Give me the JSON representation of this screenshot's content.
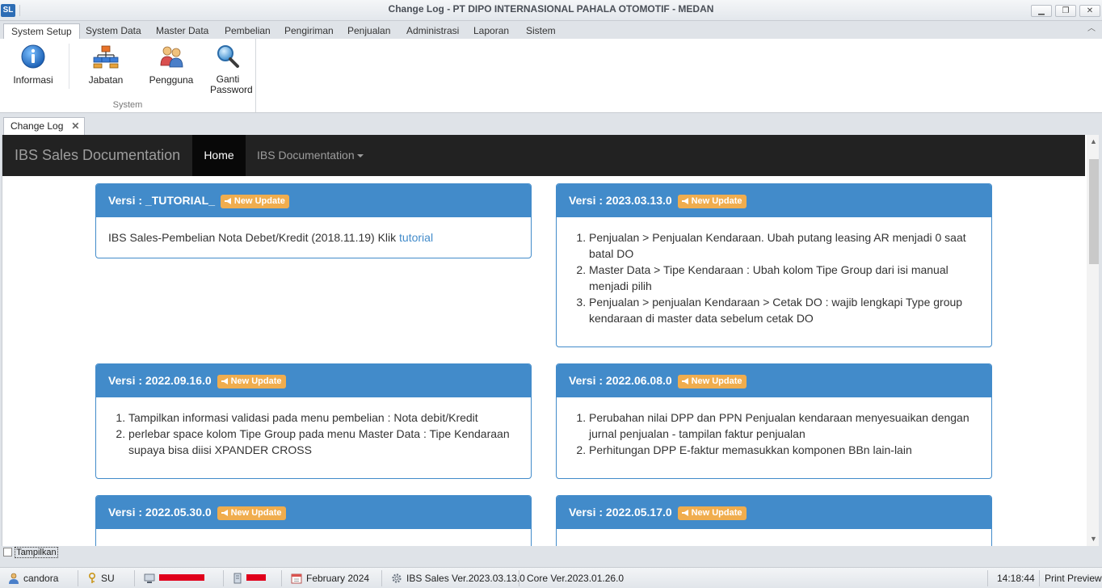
{
  "window": {
    "title": "Change Log - PT DIPO INTERNASIONAL PAHALA OTOMOTIF - MEDAN",
    "app_icon": "SL",
    "controls": [
      "minimize-icon",
      "restore-icon",
      "close-icon"
    ]
  },
  "ribbon": {
    "tabs": [
      "System Setup",
      "System Data",
      "Master Data",
      "Pembelian",
      "Pengiriman",
      "Penjualan",
      "Administrasi",
      "Laporan",
      "Sistem"
    ],
    "active_tab": "System Setup",
    "group_label": "System",
    "buttons": [
      {
        "label": "Informasi",
        "icon": "info-icon"
      },
      {
        "label": "Jabatan",
        "icon": "org-chart-icon"
      },
      {
        "label": "Pengguna",
        "icon": "users-icon"
      },
      {
        "label": "Ganti Password",
        "icon": "key-search-icon"
      }
    ]
  },
  "doc_tab": {
    "label": "Change Log",
    "close": "✕"
  },
  "site": {
    "brand": "IBS Sales Documentation",
    "nav": {
      "home": "Home",
      "docs": "IBS Documentation"
    }
  },
  "badge_label": "New Update",
  "versions": [
    {
      "title": "Versi : _TUTORIAL_",
      "text": "IBS Sales-Pembelian Nota Debet/Kredit (2018.11.19) Klik ",
      "link": "tutorial"
    },
    {
      "title": "Versi : 2023.03.13.0",
      "items": [
        "Penjualan > Penjualan Kendaraan. Ubah putang leasing AR menjadi 0 saat batal DO",
        "Master Data > Tipe Kendaraan : Ubah kolom Tipe Group dari isi manual menjadi pilih",
        "Penjualan > penjualan Kendaraan > Cetak DO : wajib lengkapi Type group kendaraan di master data sebelum cetak DO"
      ]
    },
    {
      "title": "Versi : 2022.09.16.0",
      "items": [
        "Tampilkan informasi validasi pada menu pembelian : Nota debit/Kredit",
        "perlebar space kolom Tipe Group pada menu Master Data : Tipe Kendaraan supaya bisa diisi XPANDER CROSS"
      ]
    },
    {
      "title": "Versi : 2022.06.08.0",
      "items": [
        "Perubahan nilai DPP dan PPN Penjualan kendaraan menyesuaikan dengan jurnal penjualan - tampilan faktur penjualan",
        "Perhitungan DPP E-faktur memasukkan komponen BBn lain-lain"
      ]
    },
    {
      "title": "Versi : 2022.05.30.0"
    },
    {
      "title": "Versi : 2022.05.17.0"
    }
  ],
  "tampilkan": "Tampilkan",
  "status": {
    "user": "candora",
    "role": "SU",
    "period": "February 2024",
    "app_version": "IBS Sales Ver.2023.03.13.0",
    "core_version": "Core Ver.2023.01.26.0",
    "time": "14:18:44",
    "print_preview": "Print Preview"
  },
  "colors": {
    "panel_primary": "#428bca",
    "badge_warning": "#f0ad4e",
    "navbar": "#222222",
    "redaction": "#e0001b"
  }
}
